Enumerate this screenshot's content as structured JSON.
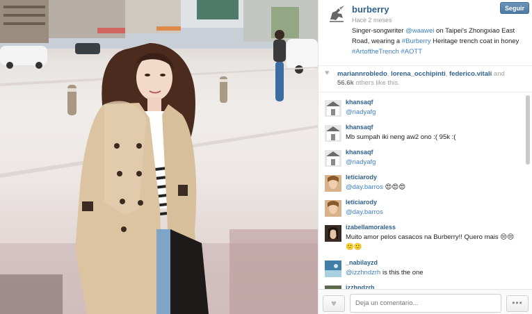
{
  "post": {
    "username": "burberry",
    "time_ago": "Hace 2 meses",
    "follow_label": "Seguir",
    "caption": {
      "part1": "Singer-songwriter ",
      "mention": "@waawei",
      "part2": " on Taipei's Zhongxiao East Road, wearing a ",
      "hashtag1": "#Burberry",
      "part3": " Heritage trench coat in honey ",
      "hashtag2": "#ArtoftheTrench",
      "part4": " ",
      "hashtag3": "#AOTT"
    }
  },
  "likes": {
    "user1": "mariannrobledo",
    "sep1": ", ",
    "user2": "lorena_occhipinti",
    "sep2": ", ",
    "user3": "federico.vitali",
    "and": " and",
    "count": "56.6k",
    "rest": " others like this."
  },
  "comments": [
    {
      "user": "khansaqf",
      "mention": "@nadyafg",
      "text": ""
    },
    {
      "user": "khansaqf",
      "mention": "",
      "text": "Mb sumpah iki neng aw2 ono :( 95k :("
    },
    {
      "user": "khansaqf",
      "mention": "@nadyafg",
      "text": ""
    },
    {
      "user": "leticiarody",
      "mention": "@day.barros",
      "text": " 😍😍😍"
    },
    {
      "user": "leticiarody",
      "mention": "@day.barros",
      "text": ""
    },
    {
      "user": "izabellamoraless",
      "mention": "",
      "text": "Muito amor pelos casacos na Burberry!! Quero mais 😒😒🙁🙁"
    },
    {
      "user": "_nabilayzd",
      "mention": "@izzhndzrh",
      "text": " is this the one"
    },
    {
      "user": "izzhndzrh",
      "mention": "",
      "text": ""
    }
  ],
  "footer": {
    "comment_placeholder": "Deja un comentario...",
    "more_label": "•••"
  },
  "colors": {
    "link": "#2f6190",
    "hashtag": "#3f7fc0",
    "follow_button": "#5a85ae"
  },
  "icons": {
    "like": "heart-icon",
    "more": "ellipsis-icon",
    "avatar": "burberry-knight-logo"
  }
}
